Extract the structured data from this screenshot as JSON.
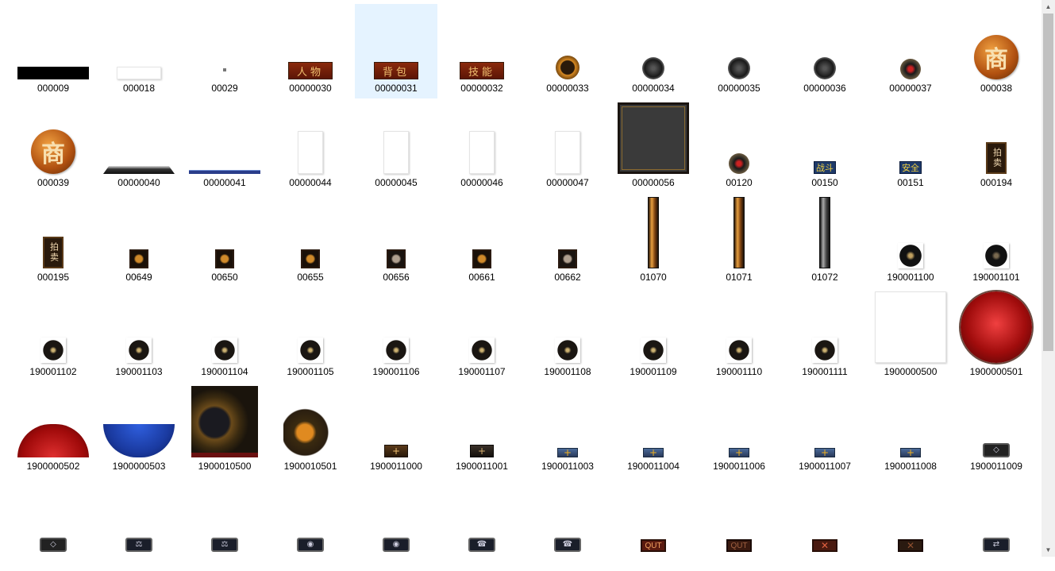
{
  "colors": {
    "selection": "#e5f3ff",
    "scrollbar_track": "#f0f0f0",
    "scrollbar_thumb": "#c1c1c1"
  },
  "scroll": {
    "position_fraction": 0.0
  },
  "items": [
    {
      "name": "000009",
      "icon": "black-bar-image",
      "selected": false
    },
    {
      "name": "000018",
      "icon": "white-bar-image",
      "selected": false
    },
    {
      "name": "00029",
      "icon": "tiny-dot-image",
      "selected": false
    },
    {
      "name": "00000030",
      "icon": "button-character",
      "text": "人物",
      "selected": false
    },
    {
      "name": "00000031",
      "icon": "button-bag",
      "text": "背包",
      "selected": true
    },
    {
      "name": "00000032",
      "icon": "button-skills",
      "text": "技能",
      "selected": false
    },
    {
      "name": "00000033",
      "icon": "round-orange-icon",
      "selected": false
    },
    {
      "name": "00000034",
      "icon": "round-dark-figure-icon",
      "selected": false
    },
    {
      "name": "00000035",
      "icon": "round-dark-bowl-icon",
      "selected": false
    },
    {
      "name": "00000036",
      "icon": "round-dark-cross-icon",
      "selected": false
    },
    {
      "name": "00000037",
      "icon": "round-mute-icon",
      "selected": false
    },
    {
      "name": "000038",
      "icon": "shop-coin-icon",
      "text": "商",
      "selected": false
    },
    {
      "name": "000039",
      "icon": "shop-coin-icon",
      "text": "商",
      "selected": false
    },
    {
      "name": "00000040",
      "icon": "dark-ledge-image",
      "selected": false
    },
    {
      "name": "00000041",
      "icon": "blue-bar-image",
      "selected": false
    },
    {
      "name": "00000044",
      "icon": "blank-page-image",
      "selected": false
    },
    {
      "name": "00000045",
      "icon": "blank-page-image",
      "selected": false
    },
    {
      "name": "00000046",
      "icon": "blank-page-image",
      "selected": false
    },
    {
      "name": "00000047",
      "icon": "blank-page-image",
      "selected": false
    },
    {
      "name": "00000056",
      "icon": "dark-panel-image",
      "selected": false
    },
    {
      "name": "00120",
      "icon": "round-mute-icon",
      "selected": false
    },
    {
      "name": "00150",
      "icon": "label-duel",
      "text": "战斗",
      "selected": false
    },
    {
      "name": "00151",
      "icon": "label-safe",
      "text": "安全",
      "selected": false
    },
    {
      "name": "000194",
      "icon": "auction-sign",
      "text": "拍卖",
      "selected": false
    },
    {
      "name": "000195",
      "icon": "auction-sign",
      "text": "拍卖",
      "selected": false
    },
    {
      "name": "00649",
      "icon": "small-orange-icon",
      "selected": false
    },
    {
      "name": "00650",
      "icon": "small-orange-icon",
      "selected": false
    },
    {
      "name": "00655",
      "icon": "small-orange-icon",
      "selected": false
    },
    {
      "name": "00656",
      "icon": "small-grey-icon",
      "selected": false
    },
    {
      "name": "00661",
      "icon": "small-orange-icon",
      "selected": false
    },
    {
      "name": "00662",
      "icon": "small-grey-icon",
      "selected": false
    },
    {
      "name": "01070",
      "icon": "vertical-bar-orange",
      "selected": false
    },
    {
      "name": "01071",
      "icon": "vertical-bar-orange",
      "selected": false
    },
    {
      "name": "01072",
      "icon": "vertical-bar-grey",
      "selected": false
    },
    {
      "name": "190001100",
      "icon": "sound-icon",
      "selected": false
    },
    {
      "name": "190001101",
      "icon": "sound-icon-dim",
      "selected": false
    },
    {
      "name": "190001102",
      "icon": "small-dark-button-icon",
      "selected": false
    },
    {
      "name": "190001103",
      "icon": "small-dark-button-icon",
      "selected": false
    },
    {
      "name": "190001104",
      "icon": "small-dark-button-icon",
      "selected": false
    },
    {
      "name": "190001105",
      "icon": "small-dark-button-icon",
      "selected": false
    },
    {
      "name": "190001106",
      "icon": "small-dark-button-icon",
      "selected": false
    },
    {
      "name": "190001107",
      "icon": "small-dark-button-icon",
      "selected": false
    },
    {
      "name": "190001108",
      "icon": "small-dark-button-icon",
      "selected": false
    },
    {
      "name": "190001109",
      "icon": "small-dark-button-icon",
      "selected": false
    },
    {
      "name": "190001110",
      "icon": "small-dark-button-icon",
      "selected": false
    },
    {
      "name": "190001111",
      "icon": "small-dark-button-icon",
      "selected": false
    },
    {
      "name": "1900000500",
      "icon": "blank-square-image",
      "selected": false
    },
    {
      "name": "1900000501",
      "icon": "red-orb-image",
      "selected": false
    },
    {
      "name": "1900000502",
      "icon": "red-orb-half-image",
      "selected": false
    },
    {
      "name": "1900000503",
      "icon": "blue-orb-half-image",
      "selected": false
    },
    {
      "name": "1900010500",
      "icon": "dragon-frame-image",
      "selected": false
    },
    {
      "name": "1900010501",
      "icon": "dragon-frame-small-image",
      "selected": false
    },
    {
      "name": "1900011000",
      "icon": "plus-button-brown",
      "selected": false
    },
    {
      "name": "1900011001",
      "icon": "plus-button-dark",
      "selected": false
    },
    {
      "name": "1900011003",
      "icon": "plus-button-blue",
      "selected": false
    },
    {
      "name": "1900011004",
      "icon": "plus-button-blue",
      "selected": false
    },
    {
      "name": "1900011006",
      "icon": "plus-button-blue",
      "selected": false
    },
    {
      "name": "1900011007",
      "icon": "plus-button-blue",
      "selected": false
    },
    {
      "name": "1900011008",
      "icon": "plus-button-blue",
      "selected": false
    },
    {
      "name": "1900011009",
      "icon": "eye-button",
      "selected": false
    },
    {
      "name": "",
      "icon": "eye-button",
      "selected": false
    },
    {
      "name": "",
      "icon": "scale-button",
      "selected": false
    },
    {
      "name": "",
      "icon": "scale-button",
      "selected": false
    },
    {
      "name": "",
      "icon": "group-button",
      "selected": false
    },
    {
      "name": "",
      "icon": "group-button",
      "selected": false
    },
    {
      "name": "",
      "icon": "phone-button",
      "selected": false
    },
    {
      "name": "",
      "icon": "phone-button",
      "selected": false
    },
    {
      "name": "",
      "icon": "quit-button",
      "text": "QUT",
      "selected": false
    },
    {
      "name": "",
      "icon": "quit-button-dim",
      "text": "QUT",
      "selected": false
    },
    {
      "name": "",
      "icon": "close-x-button",
      "selected": false
    },
    {
      "name": "",
      "icon": "close-x-button-dim",
      "selected": false
    },
    {
      "name": "",
      "icon": "swap-button",
      "selected": false
    }
  ]
}
